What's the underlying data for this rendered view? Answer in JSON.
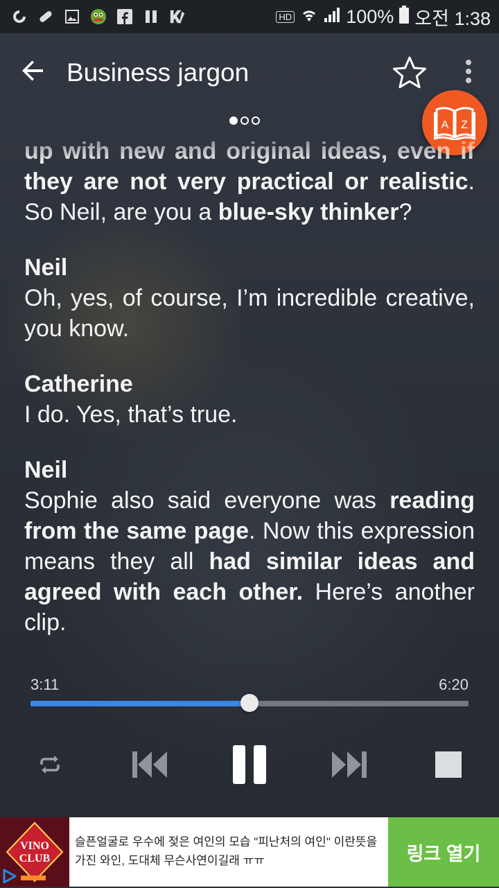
{
  "status_bar": {
    "battery": "100%",
    "time": "오전 1:38",
    "hd_label": "HD",
    "icons": [
      "g-app-icon",
      "pill-icon",
      "image-icon",
      "frog-avatar-icon",
      "facebook-icon",
      "pause-app-icon",
      "k-app-icon",
      "hd-icon",
      "wifi-icon",
      "signal-icon",
      "battery-icon"
    ]
  },
  "toolbar": {
    "title": "Business jargon",
    "back_icon": "arrow-back-icon",
    "favorite_icon": "star-outline-icon",
    "menu_icon": "more-vert-icon"
  },
  "pager": {
    "count": 3,
    "active": 0
  },
  "dictionary_button": {
    "icon": "book-az-icon",
    "letters": "A Z",
    "color": "#f05a22"
  },
  "transcript": {
    "p0": {
      "t1": "up with new and original ideas, even if they are not very practical or realistic",
      "t2": ". So Neil, are you a ",
      "t3": "blue-sky thinker",
      "t4": "?"
    },
    "p1": {
      "speaker": "Neil",
      "text": "Oh, yes, of course, I’m incredible creative, you know."
    },
    "p2": {
      "speaker": "Catherine",
      "text": "I do. Yes, that’s true."
    },
    "p3": {
      "speaker": "Neil",
      "t1": "Sophie also said everyone was ",
      "t2": "reading from the same page",
      "t3": ". Now this expression means they all ",
      "t4": "had similar ideas and agreed with each other.",
      "t5": " Here’s another clip."
    }
  },
  "player": {
    "current_time": "3:11",
    "total_time": "6:20",
    "progress_fraction": 0.5,
    "accent_color": "#3c86e6",
    "controls": [
      "repeat-icon",
      "skip-previous-icon",
      "pause-icon",
      "skip-next-icon",
      "stop-icon"
    ]
  },
  "ad": {
    "logo_text_1": "VINO",
    "logo_text_2": "CLUB",
    "text": "슬픈얼굴로 우수에 젖은 여인의 모습 \"피난처의 여인\" 이란뜻을 가진 와인, 도대체 무슨사연이길래 ㅠㅠ",
    "button": "링크 열기",
    "button_color": "#6bbf46"
  }
}
